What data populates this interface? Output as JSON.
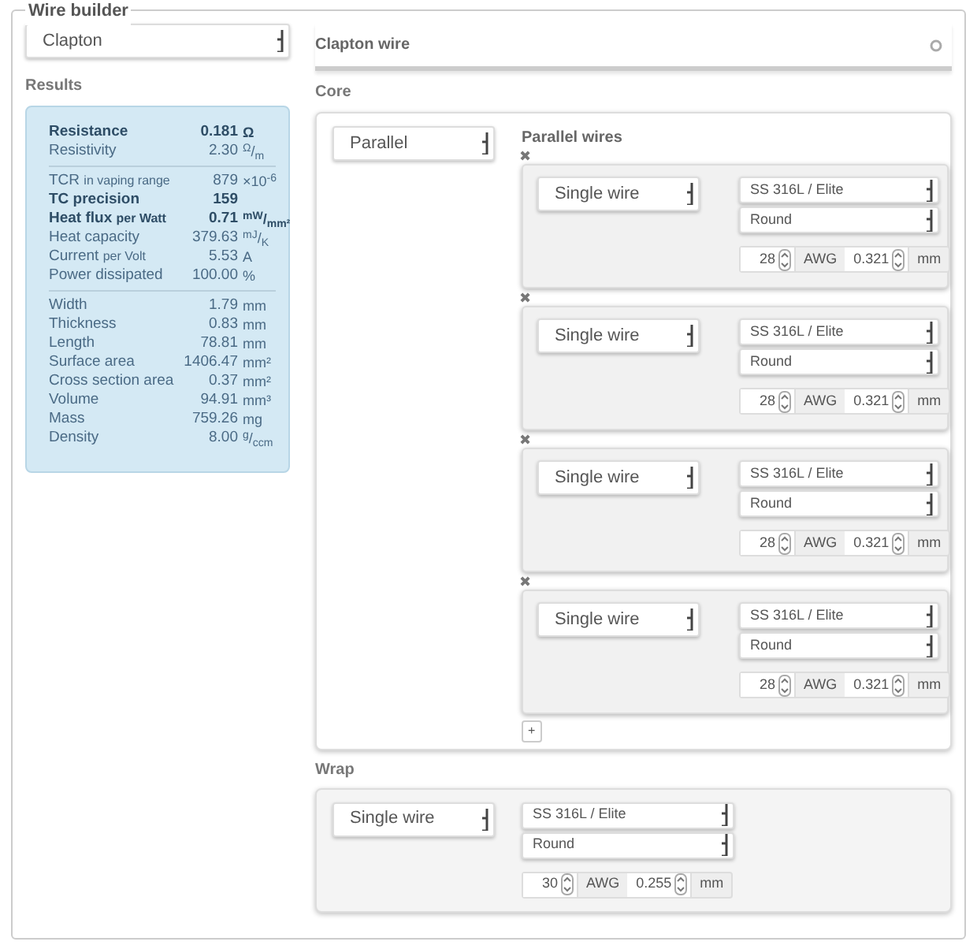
{
  "legend": "Wire builder",
  "wire_type": "Clapton",
  "results": {
    "title": "Results",
    "groups": [
      [
        {
          "label": "Resistance",
          "value": "0.181",
          "unit": "Ω",
          "bold": true
        },
        {
          "label": "Resistivity",
          "value": "2.30",
          "unit": "$^{Ω}$/$_{m}$",
          "bold": false
        }
      ],
      [
        {
          "label": "TCR",
          "label_small": "in vaping range",
          "value": "879",
          "unit": "×10$^{-6}$",
          "bold": false
        },
        {
          "label": "TC precision",
          "value": "159",
          "bold": true
        },
        {
          "label": "Heat flux",
          "label_small": "per Watt",
          "value": "0.71",
          "unit": "$^{mW}$/$_{mm²}$",
          "bold": true
        },
        {
          "label": "Heat capacity",
          "value": "379.63",
          "unit": "$^{mJ}$/$_{K}$",
          "bold": false
        },
        {
          "label": "Current",
          "label_small": "per Volt",
          "value": "5.53",
          "unit": "A",
          "bold": false
        },
        {
          "label": "Power dissipated",
          "value": "100.00",
          "unit": "%",
          "bold": false
        }
      ],
      [
        {
          "label": "Width",
          "value": "1.79",
          "unit": "mm",
          "bold": false
        },
        {
          "label": "Thickness",
          "value": "0.83",
          "unit": "mm",
          "bold": false
        },
        {
          "label": "Length",
          "value": "78.81",
          "unit": "mm",
          "bold": false
        },
        {
          "label": "Surface area",
          "value": "1406.47",
          "unit": "mm²",
          "bold": false
        },
        {
          "label": "Cross section area",
          "value": "0.37",
          "unit": "mm²",
          "bold": false
        },
        {
          "label": "Volume",
          "value": "94.91",
          "unit": "mm³",
          "bold": false
        },
        {
          "label": "Mass",
          "value": "759.26",
          "unit": "mg",
          "bold": false
        },
        {
          "label": "Density",
          "value": "8.00",
          "unit": "$^{g}$/$_{ccm}$",
          "bold": false
        }
      ]
    ]
  },
  "panel_title": "Clapton wire",
  "core": {
    "title": "Core",
    "type": "Parallel",
    "list_title": "Parallel wires",
    "add_label": "+",
    "wires": [
      {
        "remove": "✖",
        "type": "Single wire",
        "material": "SS 316L / Elite",
        "shape": "Round",
        "gauge": "28",
        "gauge_unit": "AWG",
        "diameter": "0.321",
        "diameter_unit": "mm"
      },
      {
        "remove": "✖",
        "type": "Single wire",
        "material": "SS 316L / Elite",
        "shape": "Round",
        "gauge": "28",
        "gauge_unit": "AWG",
        "diameter": "0.321",
        "diameter_unit": "mm"
      },
      {
        "remove": "✖",
        "type": "Single wire",
        "material": "SS 316L / Elite",
        "shape": "Round",
        "gauge": "28",
        "gauge_unit": "AWG",
        "diameter": "0.321",
        "diameter_unit": "mm"
      },
      {
        "remove": "✖",
        "type": "Single wire",
        "material": "SS 316L / Elite",
        "shape": "Round",
        "gauge": "28",
        "gauge_unit": "AWG",
        "diameter": "0.321",
        "diameter_unit": "mm"
      }
    ]
  },
  "wrap": {
    "title": "Wrap",
    "type": "Single wire",
    "material": "SS 316L / Elite",
    "shape": "Round",
    "gauge": "30",
    "gauge_unit": "AWG",
    "diameter": "0.255",
    "diameter_unit": "mm"
  }
}
